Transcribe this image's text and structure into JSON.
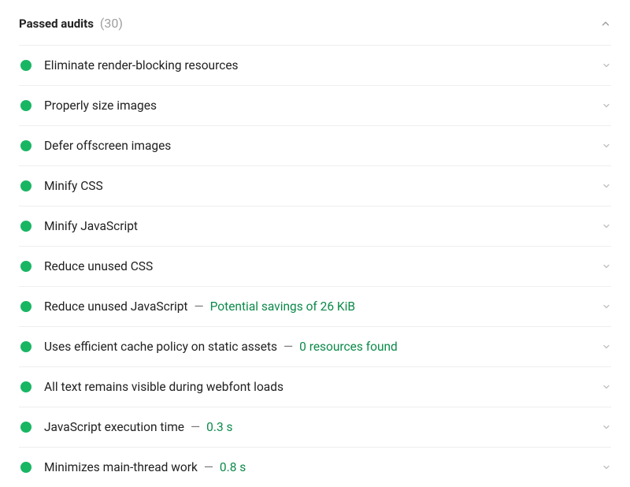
{
  "header": {
    "title": "Passed audits",
    "count": "(30)"
  },
  "audits": [
    {
      "label": "Eliminate render-blocking resources",
      "detail": ""
    },
    {
      "label": "Properly size images",
      "detail": ""
    },
    {
      "label": "Defer offscreen images",
      "detail": ""
    },
    {
      "label": "Minify CSS",
      "detail": ""
    },
    {
      "label": "Minify JavaScript",
      "detail": ""
    },
    {
      "label": "Reduce unused CSS",
      "detail": ""
    },
    {
      "label": "Reduce unused JavaScript",
      "detail": "Potential savings of 26 KiB"
    },
    {
      "label": "Uses efficient cache policy on static assets",
      "detail": "0 resources found"
    },
    {
      "label": "All text remains visible during webfont loads",
      "detail": ""
    },
    {
      "label": "JavaScript execution time",
      "detail": "0.3 s"
    },
    {
      "label": "Minimizes main-thread work",
      "detail": "0.8 s"
    }
  ],
  "separator": "—"
}
